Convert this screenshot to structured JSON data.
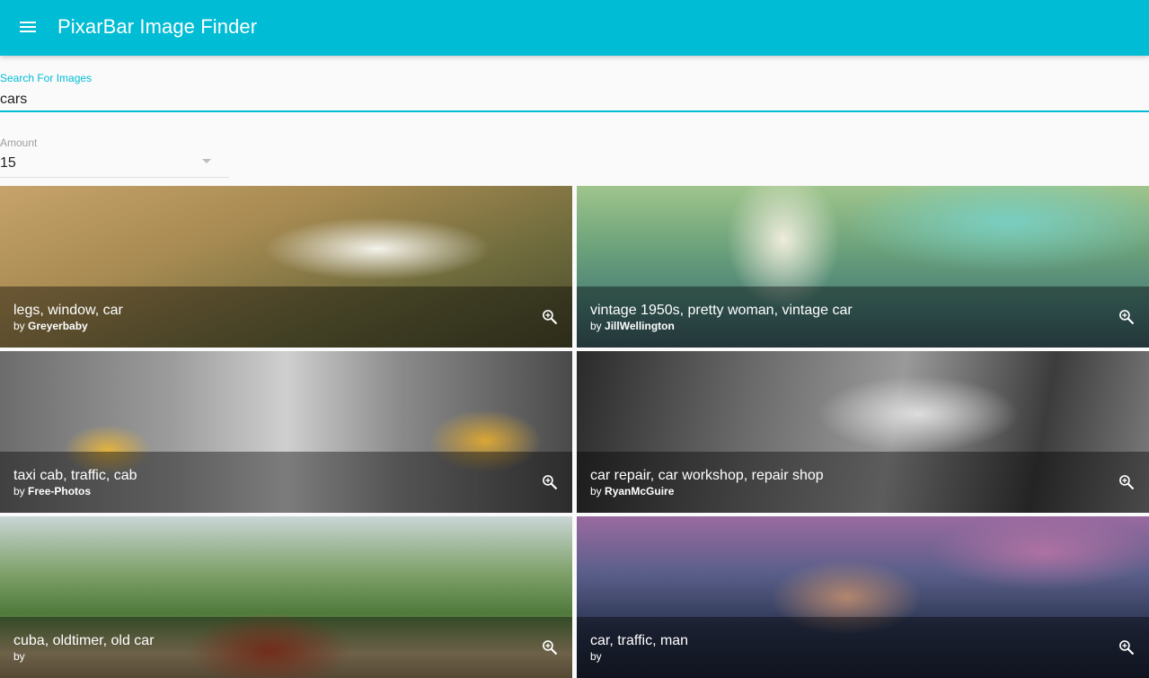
{
  "app_bar": {
    "title": "PixarBar Image Finder",
    "menu_icon": "menu-icon",
    "color": "#00bcd4"
  },
  "search": {
    "label": "Search For Images",
    "value": "cars"
  },
  "amount": {
    "label": "Amount",
    "value": "15"
  },
  "results": [
    {
      "title": "legs, window, car",
      "by": "by",
      "author": "Greyerbaby",
      "action_icon": "zoom-in-icon"
    },
    {
      "title": "vintage 1950s, pretty woman, vintage car",
      "by": "by",
      "author": "JillWellington",
      "action_icon": "zoom-in-icon"
    },
    {
      "title": "taxi cab, traffic, cab",
      "by": "by",
      "author": "Free-Photos",
      "action_icon": "zoom-in-icon"
    },
    {
      "title": "car repair, car workshop, repair shop",
      "by": "by",
      "author": "RyanMcGuire",
      "action_icon": "zoom-in-icon"
    },
    {
      "title": "cuba, oldtimer, old car",
      "by": "by",
      "author": "",
      "action_icon": "zoom-in-icon"
    },
    {
      "title": "car, traffic, man",
      "by": "by",
      "author": "",
      "action_icon": "zoom-in-icon"
    }
  ]
}
